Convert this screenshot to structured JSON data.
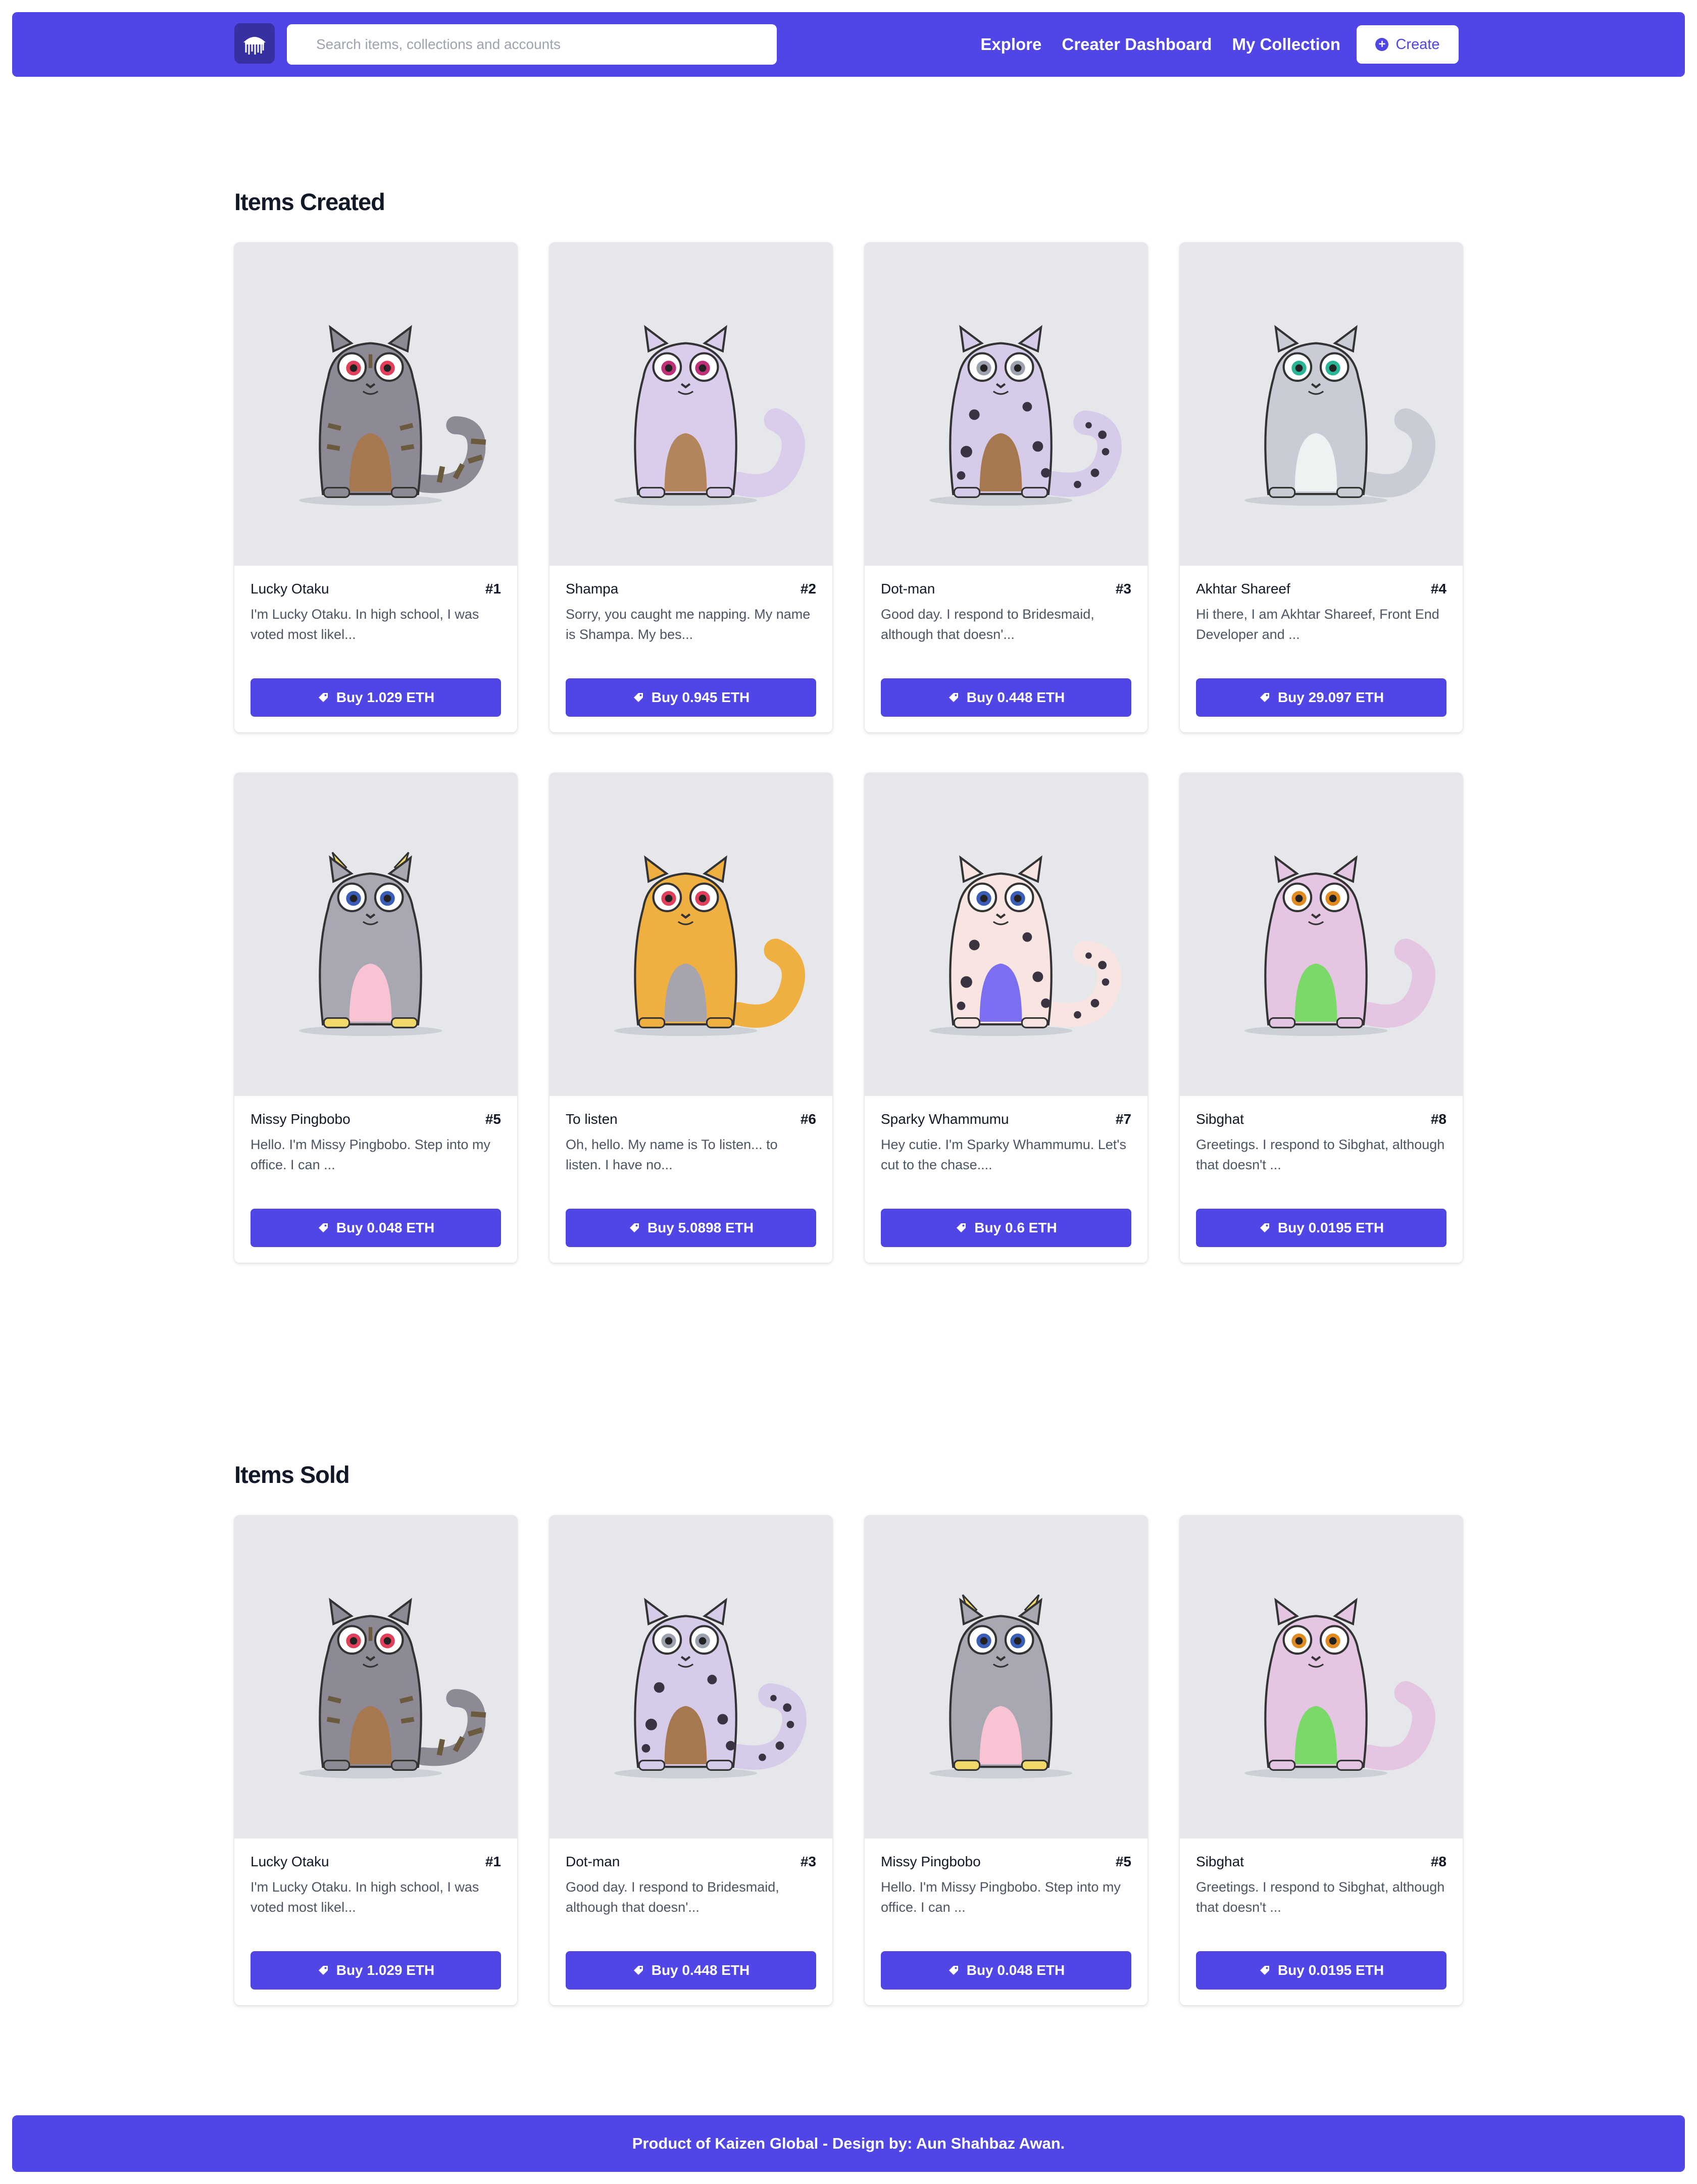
{
  "header": {
    "logo_icon": "jellyfish-logo-icon",
    "search_placeholder": "Search items, collections and accounts",
    "nav": [
      "Explore",
      "Creater Dashboard",
      "My Collection"
    ],
    "create_label": "Create",
    "create_icon": "plus-circle-icon"
  },
  "sections": [
    {
      "title": "Items Created",
      "items": [
        {
          "name": "Lucky Otaku",
          "number": "#1",
          "description": "I'm Lucky Otaku. In high school, I was voted most likel...",
          "buy_label": "Buy 1.029 ETH",
          "cat": "tabby"
        },
        {
          "name": "Shampa",
          "number": "#2",
          "description": "Sorry, you caught me napping. My name is Shampa. My bes...",
          "buy_label": "Buy 0.945 ETH",
          "cat": "lavender"
        },
        {
          "name": "Dot-man",
          "number": "#3",
          "description": "Good day. I respond to Bridesmaid, although that doesn'...",
          "buy_label": "Buy 0.448 ETH",
          "cat": "dotted"
        },
        {
          "name": "Akhtar Shareef",
          "number": "#4",
          "description": "Hi there, I am Akhtar Shareef, Front End Developer and ...",
          "buy_label": "Buy 29.097 ETH",
          "cat": "silver"
        },
        {
          "name": "Missy Pingbobo",
          "number": "#5",
          "description": "Hello. I'm Missy Pingbobo. Step into my office. I can ...",
          "buy_label": "Buy 0.048 ETH",
          "cat": "grey"
        },
        {
          "name": "To listen",
          "number": "#6",
          "description": "Oh, hello. My name is To listen... to listen. I have no...",
          "buy_label": "Buy 5.0898 ETH",
          "cat": "orange"
        },
        {
          "name": "Sparky Whammumu",
          "number": "#7",
          "description": "Hey cutie. I'm Sparky Whammumu. Let's cut to the chase....",
          "buy_label": "Buy 0.6 ETH",
          "cat": "spotted"
        },
        {
          "name": "Sibghat",
          "number": "#8",
          "description": "Greetings. I respond to Sibghat, although that doesn't ...",
          "buy_label": "Buy 0.0195 ETH",
          "cat": "pink"
        }
      ]
    },
    {
      "title": "Items Sold",
      "items": [
        {
          "name": "Lucky Otaku",
          "number": "#1",
          "description": "I'm Lucky Otaku. In high school, I was voted most likel...",
          "buy_label": "Buy 1.029 ETH",
          "cat": "tabby"
        },
        {
          "name": "Dot-man",
          "number": "#3",
          "description": "Good day. I respond to Bridesmaid, although that doesn'...",
          "buy_label": "Buy 0.448 ETH",
          "cat": "dotted"
        },
        {
          "name": "Missy Pingbobo",
          "number": "#5",
          "description": "Hello. I'm Missy Pingbobo. Step into my office. I can ...",
          "buy_label": "Buy 0.048 ETH",
          "cat": "grey"
        },
        {
          "name": "Sibghat",
          "number": "#8",
          "description": "Greetings. I respond to Sibghat, although that doesn't ...",
          "buy_label": "Buy 0.0195 ETH",
          "cat": "pink"
        }
      ]
    }
  ],
  "buy_icon": "tag-icon",
  "footer": {
    "text": "Product of Kaizen Global - Design by: Aun Shahbaz Awan."
  },
  "colors": {
    "accent": "#4f46e5",
    "card_image_bg": "#e5e7eb",
    "page_bg": "#ffffff"
  }
}
